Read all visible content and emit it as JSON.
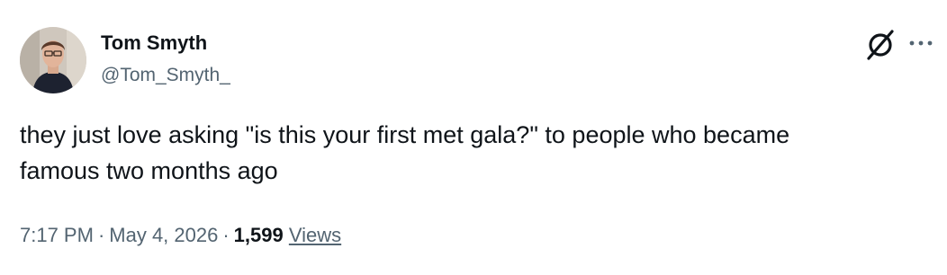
{
  "author": {
    "display_name": "Tom Smyth",
    "handle": "@Tom_Smyth_"
  },
  "tweet": {
    "text": "they just love asking \"is this your first met gala?\" to people who became\nfamous two months ago"
  },
  "meta": {
    "time": "7:17 PM",
    "separator": "·",
    "date": "May 4, 2026",
    "views_count": "1,599",
    "views_label": "Views"
  },
  "icons": {
    "grok": "grok-icon",
    "more": "more-options-icon"
  },
  "colors": {
    "text_primary": "#0f1419",
    "text_secondary": "#536471",
    "background": "#ffffff"
  }
}
